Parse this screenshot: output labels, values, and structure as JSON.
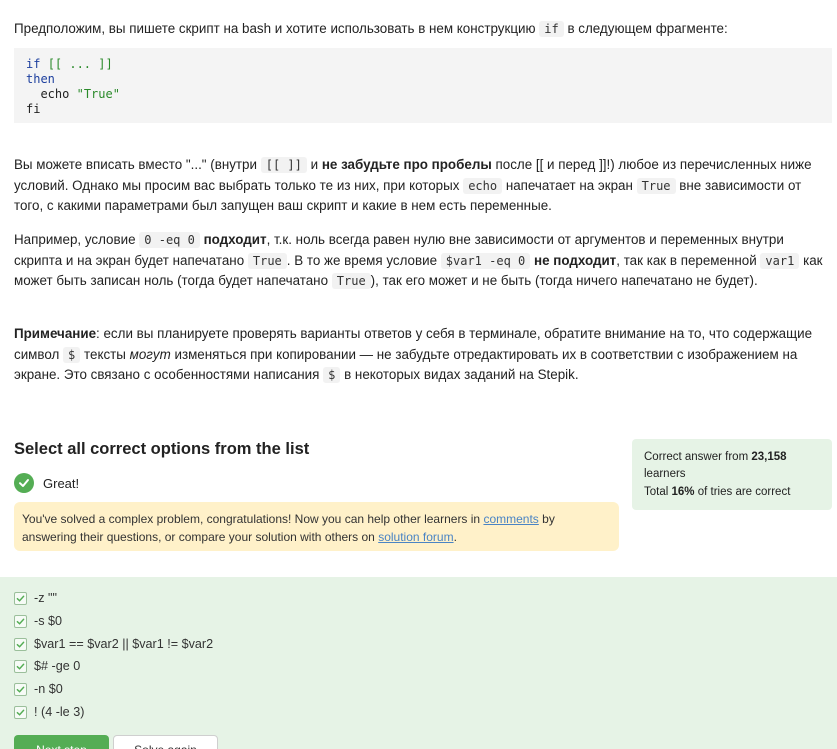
{
  "intro": {
    "before": "Предположим, вы пишете скрипт на bash и хотите использовать в нем конструкцию",
    "code": "if",
    "after": "в следующем фрагменте:"
  },
  "code_block": {
    "line1_kw": "if",
    "line1_rest": "[[ ... ]]",
    "line2": "then",
    "line3_cmd": "  echo",
    "line3_str": "\"True\"",
    "line4": "fi"
  },
  "para1": {
    "t1": "Вы можете вписать вместо \"...\" (внутри",
    "c1": "[[ ]]",
    "t2": "и",
    "b1": "не забудьте про пробелы",
    "t3": "после [[ и перед ]]!) любое из перечисленных ниже условий. Однако мы просим вас выбрать только те из них, при которых",
    "c2": "echo",
    "t4": "напечатает на экран",
    "c3": "True",
    "t5": "вне зависимости от того, с какими параметрами был запущен ваш скрипт и какие в нем есть переменные."
  },
  "para2": {
    "t1": "Например, условие",
    "c1": "0 -eq 0",
    "b1": "подходит",
    "t2": ", т.к. ноль всегда равен нулю вне зависимости от аргументов и переменных внутри скрипта и на экран будет напечатано",
    "c2": "True",
    "t3": ". В то же время условие",
    "c3": "$var1 -eq 0",
    "b2": "не подходит",
    "t4": ", так как в переменной",
    "c4": "var1",
    "t5": "как может быть записан ноль (тогда будет напечатано",
    "c5": "True",
    "t6": "), так его может и не быть (тогда ничего напечатано не будет)."
  },
  "note": {
    "b1": "Примечание",
    "t1": ": если вы планируете проверять варианты ответов у себя в терминале, обратите внимание на то, что содержащие символ",
    "c1": "$",
    "t2": "тексты",
    "i1": "могут",
    "t3": "изменяться при копировании — не забудьте отредактировать их в соответствии с изображением на экране. Это связано с особенностями написания",
    "c2": "$",
    "t4": "в некоторых видах заданий на Stepik."
  },
  "task": {
    "title": "Select all correct options from the list",
    "status": "Great!",
    "notice_before": "You've solved a complex problem, congratulations! Now you can help other learners in",
    "notice_link1": "comments",
    "notice_middle": "by answering their questions, or compare your solution with others on",
    "notice_link2": "solution forum",
    "notice_end": "."
  },
  "stats": {
    "line1_before": "Correct answer from",
    "learners_count": "23,158",
    "line1_after": "learners",
    "line2_before": "Total",
    "percent": "16%",
    "line2_after": "of tries are correct"
  },
  "options": [
    {
      "label": "-z \"\"",
      "checked": true
    },
    {
      "label": "-s $0",
      "checked": true
    },
    {
      "label": "$var1 == $var2 || $var1 != $var2",
      "checked": true
    },
    {
      "label": "$# -ge 0",
      "checked": true
    },
    {
      "label": "-n $0",
      "checked": true
    },
    {
      "label": "! (4 -le 3)",
      "checked": true
    }
  ],
  "buttons": {
    "primary": "Next step",
    "secondary": "Solve again"
  },
  "colors": {
    "accent_green": "#54ad54",
    "options_bg": "#e6f3e6",
    "notice_bg": "#fff1c9",
    "link": "#4a84c4"
  }
}
